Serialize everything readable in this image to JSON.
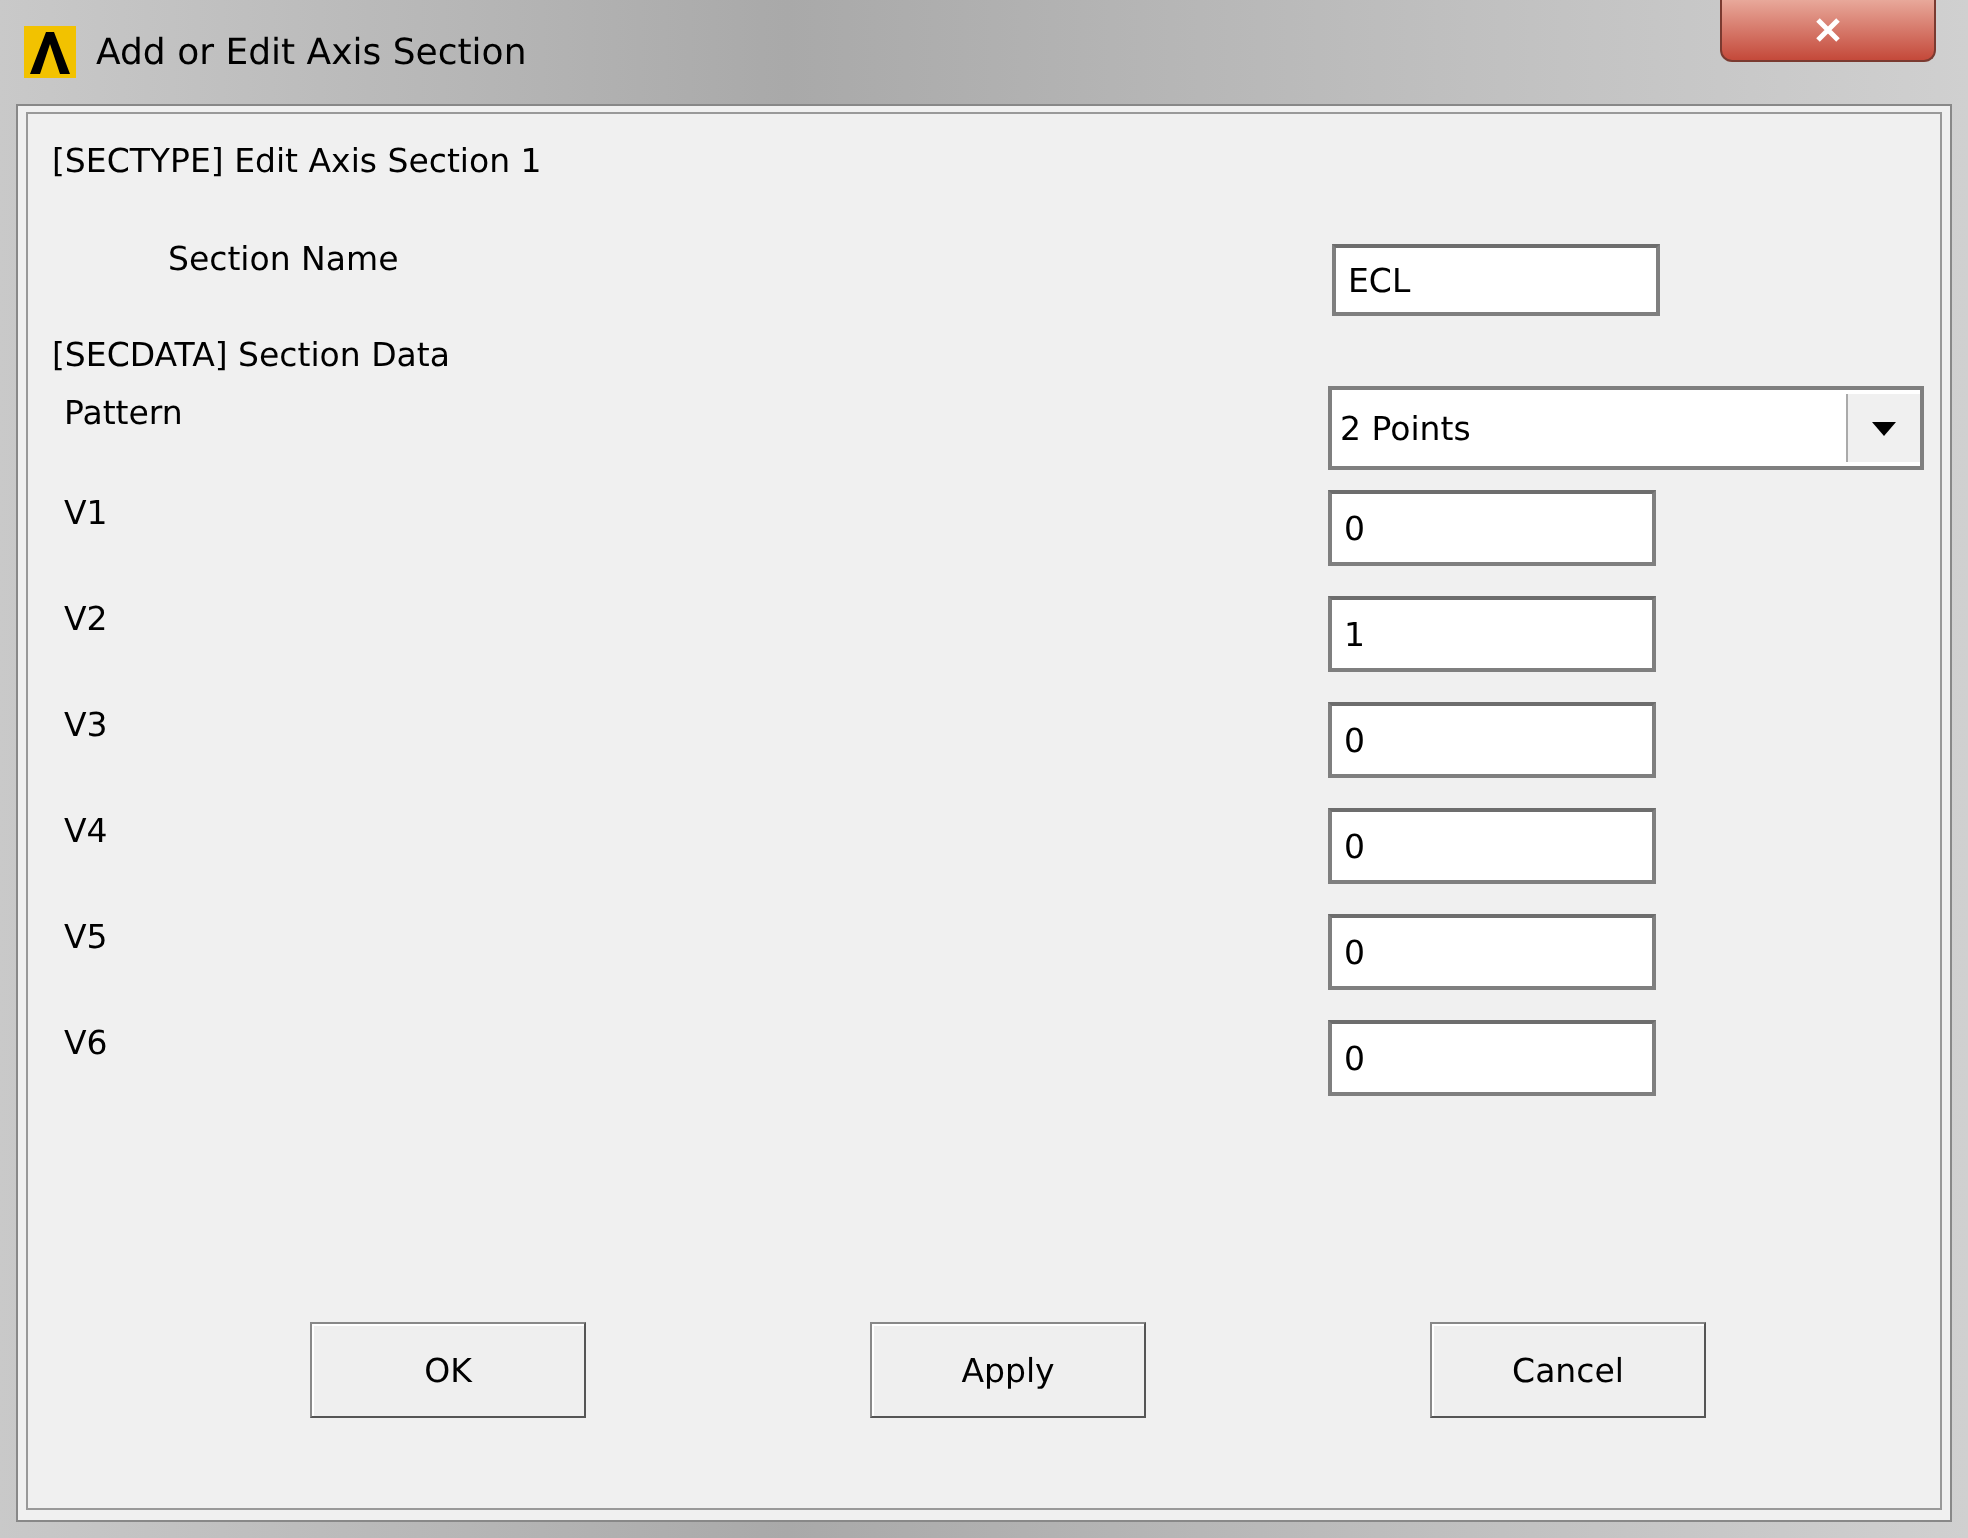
{
  "window": {
    "title": "Add or Edit Axis Section"
  },
  "sectype_heading": "[SECTYPE]  Edit Axis Section 1",
  "section_name": {
    "label": "Section Name",
    "value": "ECL"
  },
  "secdata_heading": "[SECDATA] Section Data",
  "pattern": {
    "label": "Pattern",
    "value": "2 Points"
  },
  "values": [
    {
      "label": "V1",
      "value": "0"
    },
    {
      "label": "V2",
      "value": "1"
    },
    {
      "label": "V3",
      "value": "0"
    },
    {
      "label": "V4",
      "value": "0"
    },
    {
      "label": "V5",
      "value": "0"
    },
    {
      "label": "V6",
      "value": "0"
    }
  ],
  "buttons": [
    "OK",
    "Apply",
    "Cancel"
  ]
}
